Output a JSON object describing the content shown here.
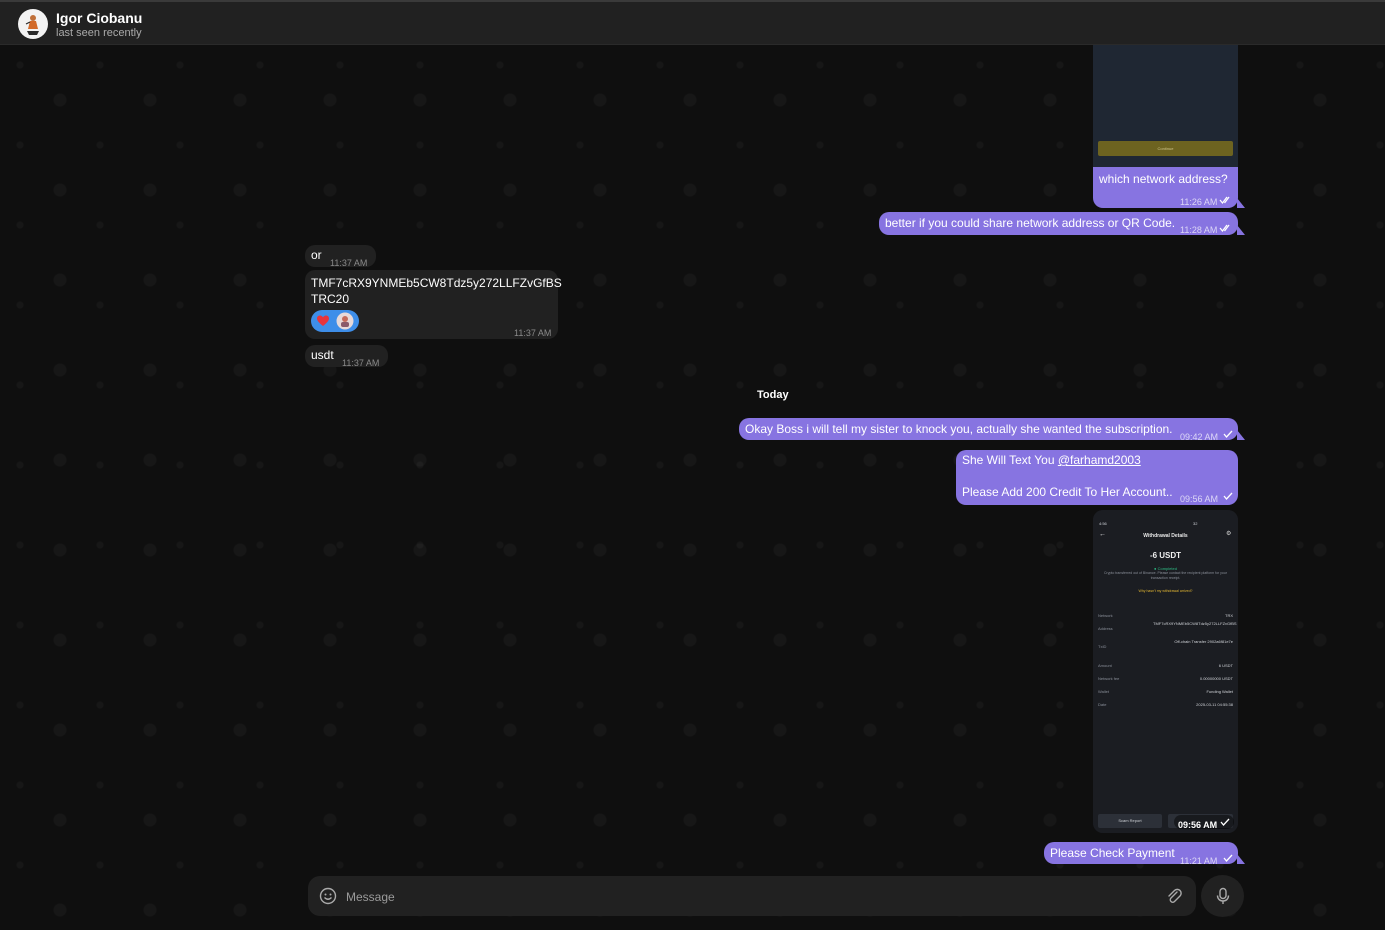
{
  "header": {
    "name": "Igor Ciobanu",
    "status": "last seen recently"
  },
  "date_separator": "Today",
  "messages": [
    {
      "side": "out",
      "text": "which network address?",
      "time": "11:26 AM",
      "ticks": "double"
    },
    {
      "side": "out",
      "text": "better if you could share network address or QR Code.",
      "time": "11:28 AM",
      "ticks": "double"
    },
    {
      "side": "in",
      "text": "or",
      "time": "11:37 AM"
    },
    {
      "side": "in",
      "text_line1": "TMF7cRX9YNMEb5CW8Tdz5y272LLFZvGfBS",
      "text_line2": "TRC20",
      "time": "11:37 AM",
      "reactions": [
        "heart",
        "avatar"
      ]
    },
    {
      "side": "in",
      "text": "usdt",
      "time": "11:37 AM"
    },
    {
      "side": "out",
      "text": "Okay Boss i will tell my sister to knock you, actually she wanted the subscription.",
      "time": "09:42 AM",
      "ticks": "single"
    },
    {
      "side": "out",
      "text_prefix": "She Will Text You ",
      "mention": "@farhamd2003",
      "text_line2": "Please Add 200 Credit To Her Account..",
      "time": "09:56 AM",
      "ticks": "single"
    },
    {
      "side": "out",
      "type": "image",
      "time": "09:56 AM",
      "ticks": "single"
    },
    {
      "side": "out",
      "text": "Please Check Payment",
      "time": "11:21 AM",
      "ticks": "single"
    }
  ],
  "image_top": {
    "button": "Continue"
  },
  "screenshot": {
    "status_left": "4:56",
    "status_right": "32",
    "title": "Withdrawal Details",
    "amount": "-6 USDT",
    "state": "Completed",
    "note": "Crypto transferred out of Binance. Please contact the recipient platform for your transaction receipt.",
    "link": "Why hasn't my withdrawal arrived?",
    "rows": [
      {
        "label": "Network",
        "value": "TRX"
      },
      {
        "label": "Address",
        "value": "TMF7cRX9YNMEb5CW8Tdz5y272LLFZvGfBS"
      },
      {
        "label": "TxID",
        "value": "Off-chain Transfer 2902a6f81e7e"
      },
      {
        "label": "Amount",
        "value": "6 USDT"
      },
      {
        "label": "Network fee",
        "value": "0.00000000 USDT"
      },
      {
        "label": "Wallet",
        "value": "Funding Wallet"
      },
      {
        "label": "Date",
        "value": "2025-03-11 04:55:38"
      }
    ],
    "scam_button": "Scam Report"
  },
  "composer": {
    "placeholder": "Message"
  },
  "colors": {
    "outgoing": "#8774e1",
    "incoming": "#212121",
    "background": "#0f0f0f",
    "header": "#212121"
  }
}
